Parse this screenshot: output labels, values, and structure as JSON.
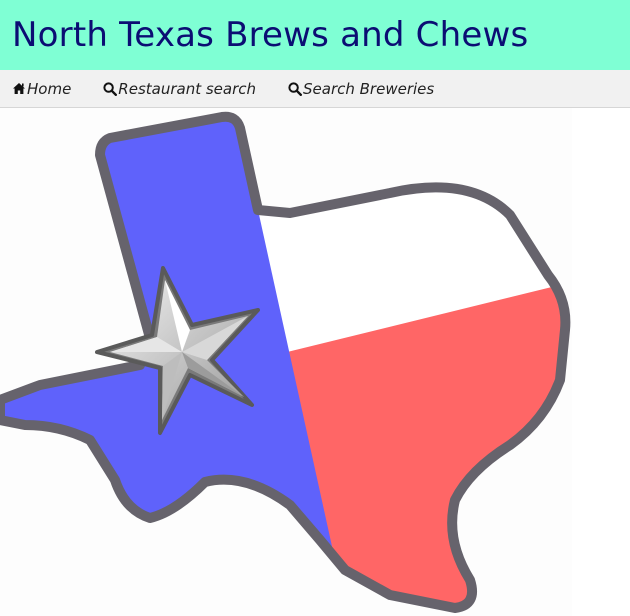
{
  "header": {
    "title": "North Texas Brews and Chews"
  },
  "nav": {
    "items": [
      {
        "label": "Home",
        "icon": "home-icon"
      },
      {
        "label": "Restaurant search",
        "icon": "search-icon"
      },
      {
        "label": "Search Breweries",
        "icon": "search-icon"
      }
    ]
  },
  "colors": {
    "header_bg": "#7fffd4",
    "title": "#0b0d73",
    "flag_blue": "#5f62fb",
    "flag_red": "#ff6666",
    "flag_white": "#ffffff",
    "outline": "#66636c"
  },
  "logo": {
    "icon": "texas-flag-map-logo"
  }
}
